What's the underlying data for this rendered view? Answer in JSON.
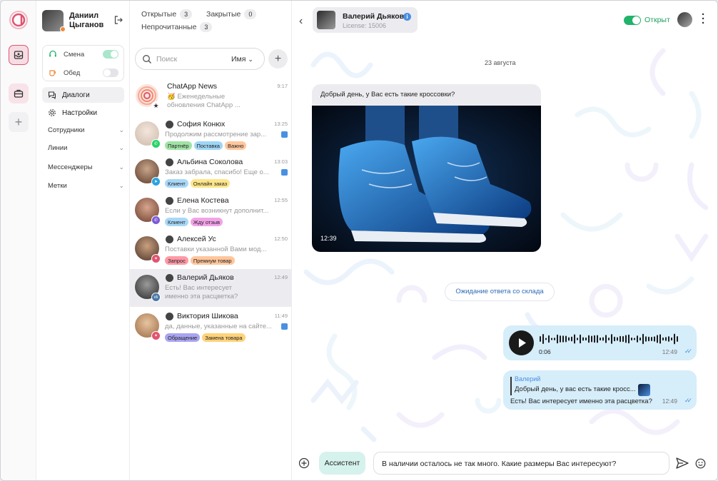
{
  "user": {
    "name": "Даниил Цыганов"
  },
  "shift": {
    "shift_label": "Смена",
    "lunch_label": "Обед",
    "shift_on": true,
    "lunch_on": false
  },
  "nav": {
    "dialogs": "Диалоги",
    "settings": "Настройки",
    "sections": [
      "Сотрудники",
      "Линии",
      "Мессенджеры",
      "Метки"
    ]
  },
  "filters": {
    "open_label": "Открытые",
    "open_count": "3",
    "closed_label": "Закрытые",
    "closed_count": "0",
    "unread_label": "Непрочитанные",
    "unread_count": "3"
  },
  "search": {
    "placeholder": "Поиск",
    "sort": "Имя"
  },
  "chats": [
    {
      "name": "ChatApp News",
      "time": "9:17",
      "preview": "🥳 Еженедельные обновления ChatApp ...",
      "tags": [],
      "unread": false
    },
    {
      "name": "София Конюх",
      "time": "13:25",
      "preview": "Продолжим рассмотрение зар...",
      "tags": [
        "Партнёр",
        "Поставка",
        "Важно"
      ],
      "unread": true
    },
    {
      "name": "Альбина Соколова",
      "time": "13:03",
      "preview": "Заказ забрала, спасибо! Еще о...",
      "tags": [
        "Клиент",
        "Онлайн заказ"
      ],
      "unread": true
    },
    {
      "name": "Елена Костева",
      "time": "12:55",
      "preview": "Если у Вас возникнут дополнит...",
      "tags": [
        "Клиент",
        "Жду отзыв"
      ],
      "unread": false
    },
    {
      "name": "Алексей Ус",
      "time": "12:50",
      "preview": "Поставки указанной Вами мод...",
      "tags": [
        "Запрос",
        "Премиум товар"
      ],
      "unread": false
    },
    {
      "name": "Валерий Дьяков",
      "time": "12:49",
      "preview": "Есть! Вас интересует именно эта расцветка?",
      "tags": [],
      "unread": false
    },
    {
      "name": "Виктория Шикова",
      "time": "11:49",
      "preview": "да, данные, указанные на сайте...",
      "tags": [
        "Обращение",
        "Замена товара"
      ],
      "unread": true
    }
  ],
  "header": {
    "contact_name": "Валерий Дьяков",
    "license": "License: 15006",
    "status": "Открыт"
  },
  "messages": {
    "date": "23 августа",
    "incoming_text": "Добрый день, у Вас есть такие кроссовки?",
    "incoming_time": "12:39",
    "system_note": "Ожидание ответа со склада",
    "voice_duration": "0:06",
    "voice_time": "12:49",
    "reply_author": "Валерий",
    "reply_quote": "Добрый день, у вас есть такие кросс...",
    "reply_text": "Есть! Вас интересует именно эта расцветка?",
    "reply_time": "12:49"
  },
  "composer": {
    "assistant": "Ассистент",
    "value": "В наличии осталось не так много. Какие размеры Вас интересуют?"
  },
  "colors": {
    "accent": "#e0546f",
    "online": "#21b36b",
    "bubble_out": "#d6edfa",
    "link": "#4a90e2"
  }
}
